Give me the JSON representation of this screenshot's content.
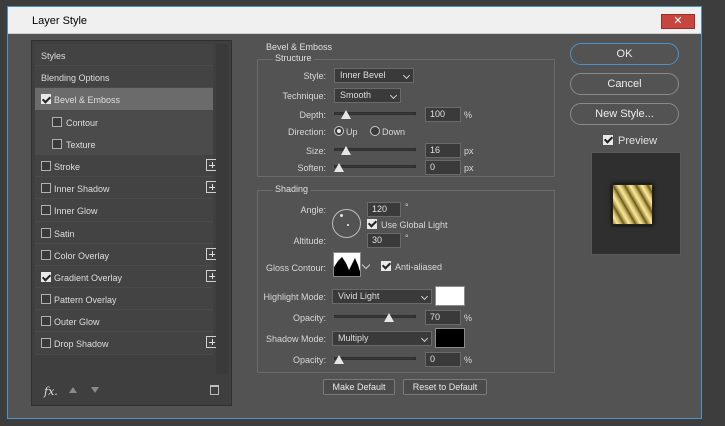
{
  "window": {
    "title": "Layer Style",
    "close": "✕"
  },
  "styles": {
    "header": "Styles",
    "blending": "Blending Options",
    "items": [
      {
        "label": "Bevel & Emboss",
        "checked": true,
        "selected": true,
        "plus": false
      },
      {
        "label": "Contour",
        "checked": false,
        "sub": true,
        "plus": false
      },
      {
        "label": "Texture",
        "checked": false,
        "sub": true,
        "plus": false
      },
      {
        "label": "Stroke",
        "checked": false,
        "plus": true
      },
      {
        "label": "Inner Shadow",
        "checked": false,
        "plus": true
      },
      {
        "label": "Inner Glow",
        "checked": false,
        "plus": false
      },
      {
        "label": "Satin",
        "checked": false,
        "plus": false
      },
      {
        "label": "Color Overlay",
        "checked": false,
        "plus": true
      },
      {
        "label": "Gradient Overlay",
        "checked": true,
        "plus": true
      },
      {
        "label": "Pattern Overlay",
        "checked": false,
        "plus": false
      },
      {
        "label": "Outer Glow",
        "checked": false,
        "plus": false
      },
      {
        "label": "Drop Shadow",
        "checked": false,
        "plus": true
      }
    ],
    "footer": {
      "fx": "fx",
      "dot": "."
    }
  },
  "bevel": {
    "title": "Bevel & Emboss",
    "structure": {
      "title": "Structure",
      "style_label": "Style:",
      "style_value": "Inner Bevel",
      "technique_label": "Technique:",
      "technique_value": "Smooth",
      "depth_label": "Depth:",
      "depth_value": "100",
      "depth_unit": "%",
      "depth_fraction": 0.1,
      "direction_label": "Direction:",
      "direction_up": "Up",
      "direction_down": "Down",
      "direction_selected": "Up",
      "size_label": "Size:",
      "size_value": "16",
      "size_unit": "px",
      "size_fraction": 0.1,
      "soften_label": "Soften:",
      "soften_value": "0",
      "soften_unit": "px",
      "soften_fraction": 0.0
    },
    "shading": {
      "title": "Shading",
      "angle_label": "Angle:",
      "angle_value": "120",
      "angle_unit": "°",
      "global_light": "Use Global Light",
      "global_light_checked": true,
      "altitude_label": "Altitude:",
      "altitude_value": "30",
      "altitude_unit": "°",
      "gloss_label": "Gloss Contour:",
      "anti_aliased": "Anti-aliased",
      "anti_aliased_checked": true,
      "highlight_label": "Highlight Mode:",
      "highlight_value": "Vivid Light",
      "highlight_color": "#ffffff",
      "hl_opacity_label": "Opacity:",
      "hl_opacity_value": "70",
      "hl_opacity_unit": "%",
      "hl_opacity_fraction": 0.7,
      "shadow_label": "Shadow Mode:",
      "shadow_value": "Multiply",
      "shadow_color": "#000000",
      "sh_opacity_label": "Opacity:",
      "sh_opacity_value": "0",
      "sh_opacity_unit": "%",
      "sh_opacity_fraction": 0.0
    },
    "make_default": "Make Default",
    "reset_default": "Reset to Default"
  },
  "actions": {
    "ok": "OK",
    "cancel": "Cancel",
    "new_style": "New Style...",
    "preview": "Preview",
    "preview_checked": true
  }
}
